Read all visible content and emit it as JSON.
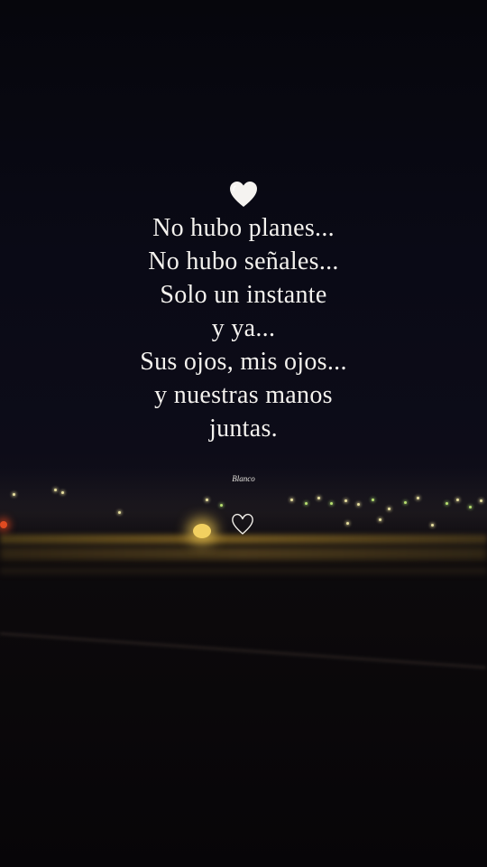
{
  "poem": {
    "lines": [
      "No hubo planes...",
      "No hubo señales...",
      "Solo un instante",
      "y ya...",
      "Sus ojos, mis ojos...",
      "y nuestras manos",
      "juntas."
    ]
  },
  "signature": "Blanco",
  "icons": {
    "top": "white-heart-icon",
    "bottom": "outline-heart-icon"
  },
  "colors": {
    "text": "#f4f2ee",
    "sky": "#070710",
    "road_light": "#b08a30"
  }
}
